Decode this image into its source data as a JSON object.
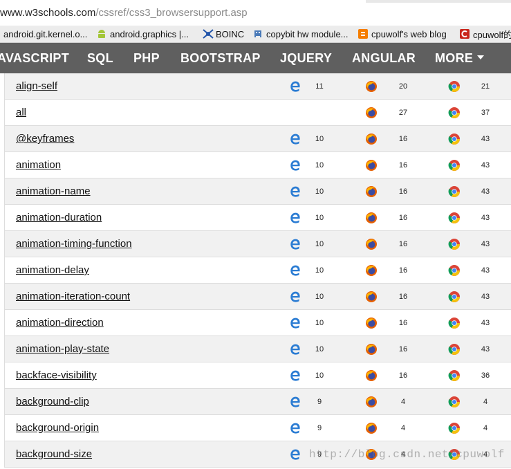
{
  "browser": {
    "url_host": "www.w3schools.com",
    "url_path": "/cssref/css3_browsersupport.asp",
    "bookmarks": [
      {
        "label": "android.git.kernel.o...",
        "icon": "page-icon"
      },
      {
        "label": "android.graphics |...",
        "icon": "android-icon"
      },
      {
        "label": "BOINC",
        "icon": "boinc-icon"
      },
      {
        "label": "copybit hw module...",
        "icon": "space-invader-icon"
      },
      {
        "label": "cpuwolf's web blog",
        "icon": "blogger-icon"
      },
      {
        "label": "cpuwolf的",
        "icon": "csdn-icon"
      }
    ]
  },
  "nav": {
    "items": [
      "AVASCRIPT",
      "SQL",
      "PHP",
      "BOOTSTRAP",
      "JQUERY",
      "ANGULAR",
      "MORE"
    ]
  },
  "table": {
    "rows": [
      {
        "property": "align-self",
        "edge": "11",
        "firefox": "20",
        "chrome": "21"
      },
      {
        "property": "all",
        "edge": "",
        "firefox": "27",
        "chrome": "37"
      },
      {
        "property": "@keyframes",
        "edge": "10",
        "firefox": "16",
        "chrome": "43"
      },
      {
        "property": "animation",
        "edge": "10",
        "firefox": "16",
        "chrome": "43"
      },
      {
        "property": "animation-name",
        "edge": "10",
        "firefox": "16",
        "chrome": "43"
      },
      {
        "property": "animation-duration",
        "edge": "10",
        "firefox": "16",
        "chrome": "43"
      },
      {
        "property": "animation-timing-function",
        "edge": "10",
        "firefox": "16",
        "chrome": "43"
      },
      {
        "property": "animation-delay",
        "edge": "10",
        "firefox": "16",
        "chrome": "43"
      },
      {
        "property": "animation-iteration-count",
        "edge": "10",
        "firefox": "16",
        "chrome": "43"
      },
      {
        "property": "animation-direction",
        "edge": "10",
        "firefox": "16",
        "chrome": "43"
      },
      {
        "property": "animation-play-state",
        "edge": "10",
        "firefox": "16",
        "chrome": "43"
      },
      {
        "property": "backface-visibility",
        "edge": "10",
        "firefox": "16",
        "chrome": "36"
      },
      {
        "property": "background-clip",
        "edge": "9",
        "firefox": "4",
        "chrome": "4"
      },
      {
        "property": "background-origin",
        "edge": "9",
        "firefox": "4",
        "chrome": "4"
      },
      {
        "property": "background-size",
        "edge": "9",
        "firefox": "4",
        "chrome": "4"
      }
    ]
  },
  "watermark": "http://blog.csdn.net/cpuwolf",
  "colors": {
    "nav_bg": "#5f5f5f",
    "edge_blue": "#2b7cd3",
    "firefox_orange": "#e66000",
    "chrome_red": "#db4437",
    "chrome_yellow": "#f4c20d",
    "chrome_green": "#0f9d58"
  }
}
